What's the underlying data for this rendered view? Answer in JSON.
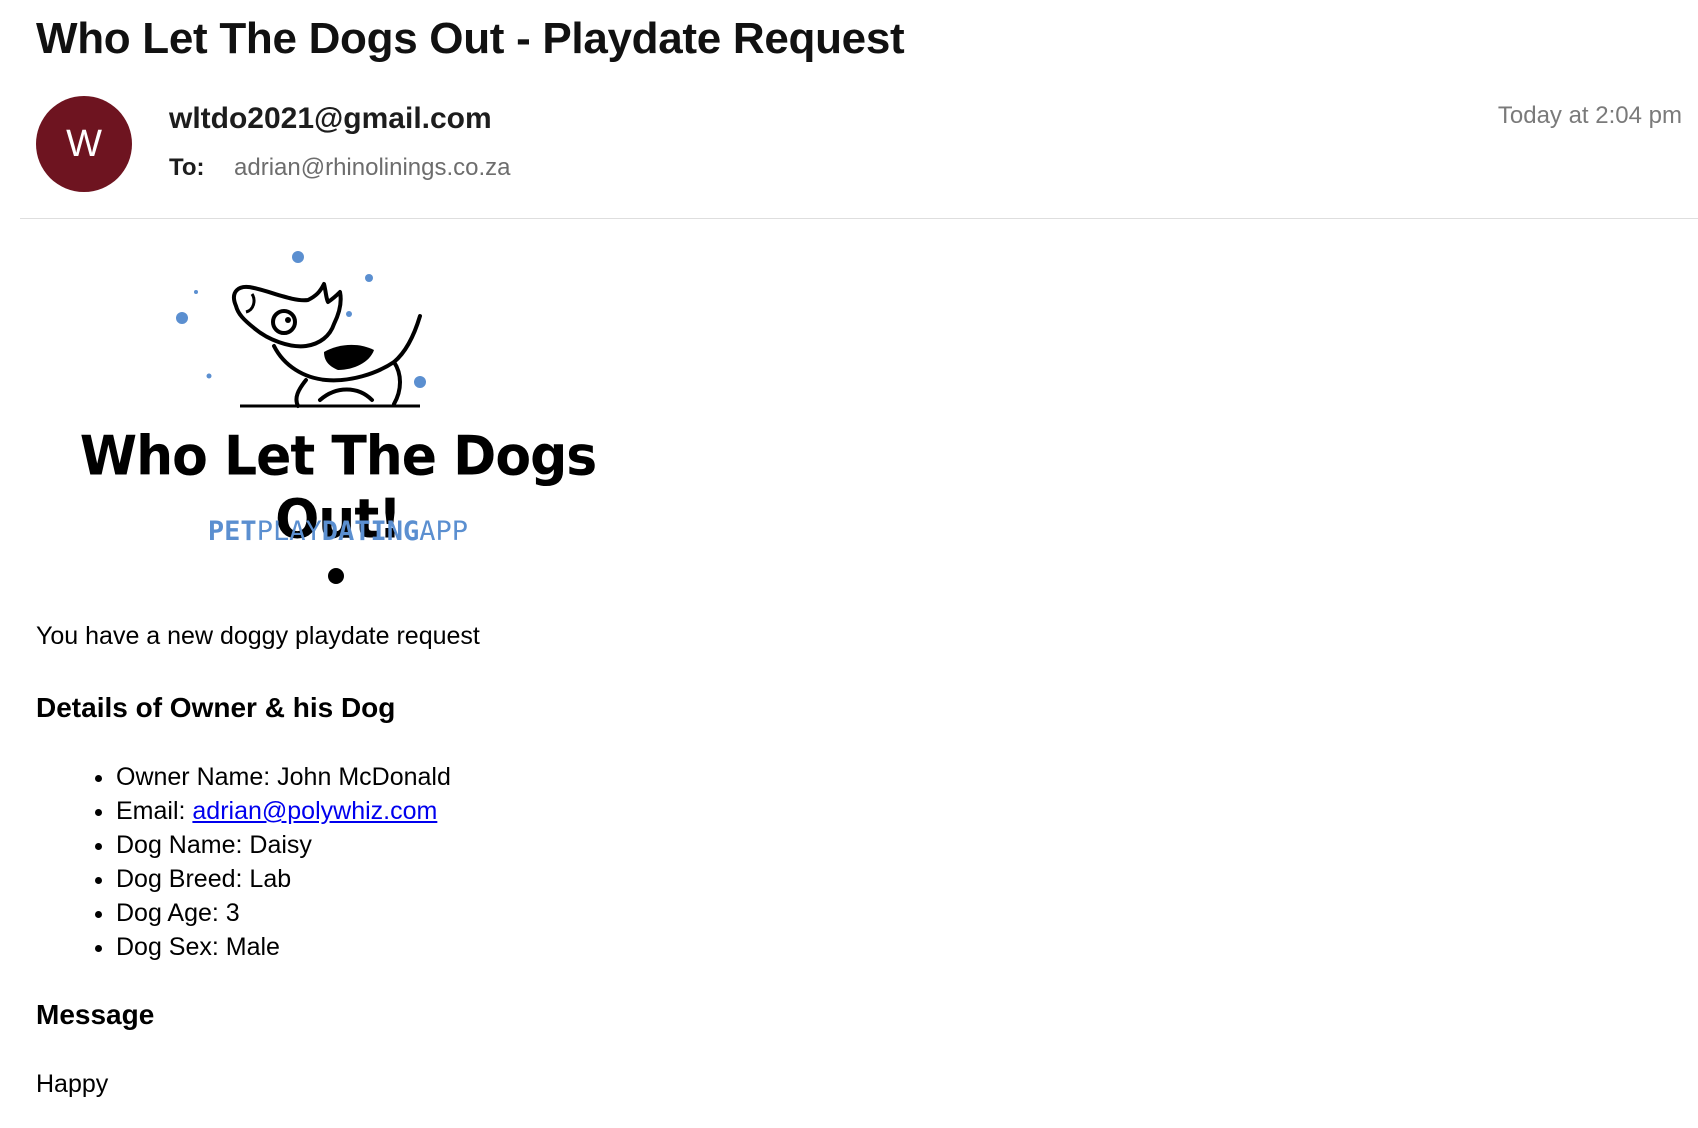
{
  "email": {
    "subject": "Who Let The Dogs Out - Playdate Request",
    "avatar_initial": "W",
    "avatar_color": "#6e1420",
    "sender": "wltdo2021@gmail.com",
    "to_label": "To:",
    "to_address": "adrian@rhinolinings.co.za",
    "date": "Today at 2:04 pm"
  },
  "logo": {
    "title": "Who Let The Dogs Out!",
    "subtitle_parts": [
      "PET",
      "PLAY",
      "DATING",
      "APP"
    ],
    "accent_color": "#5b8fd0",
    "icon": "dog-logo-icon"
  },
  "body": {
    "intro": "You have a new doggy playdate request",
    "details_heading": "Details of Owner & his Dog",
    "details": {
      "owner_name": "Owner Name: John McDonald",
      "email_label": "Email: ",
      "email_link": "adrian@polywhiz.com",
      "dog_name": "Dog Name: Daisy",
      "dog_breed": "Dog Breed: Lab",
      "dog_age": "Dog Age: 3",
      "dog_sex": "Dog Sex: Male"
    },
    "message_heading": "Message",
    "message": "Happy"
  }
}
